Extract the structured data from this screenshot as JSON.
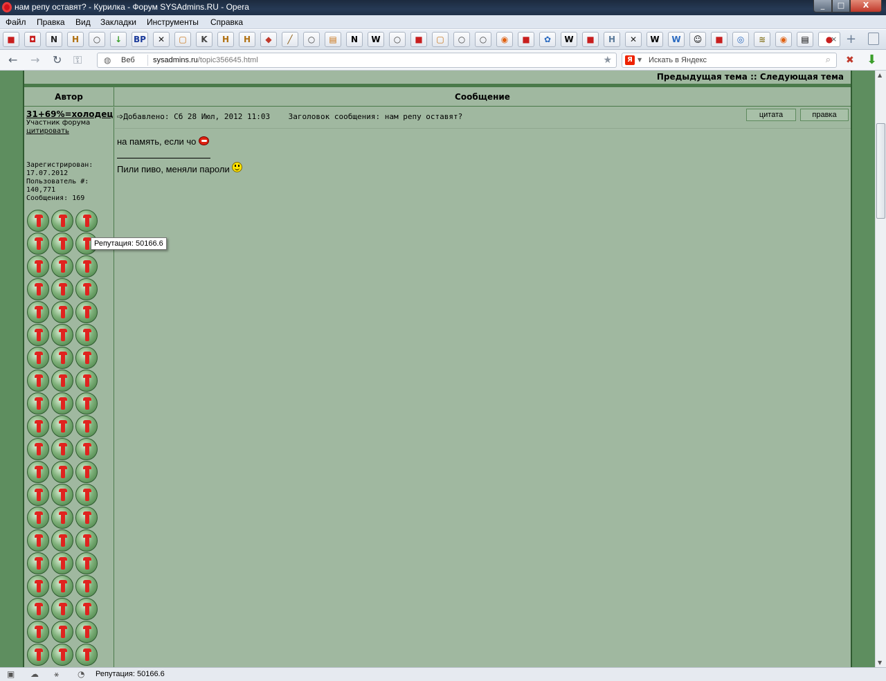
{
  "window": {
    "title": "нам репу оставят? - Курилка - Форум SYSAdmins.RU - Opera",
    "minimize": "_",
    "maximize": "□",
    "close": "X"
  },
  "menu": {
    "items": [
      "Файл",
      "Правка",
      "Вид",
      "Закладки",
      "Инструменты",
      "Справка"
    ]
  },
  "bookmarks": {
    "items": [
      "■",
      "◘",
      "N",
      "H",
      "○",
      "↓",
      "BP",
      "✕",
      "▢",
      "K",
      "H",
      "H",
      "◆",
      "╱",
      "○",
      "▤",
      "N",
      "W",
      "○",
      "■",
      "▢",
      "○",
      "○",
      "◉",
      "■",
      "✿",
      "W",
      "■",
      "H",
      "✕",
      "W",
      "W",
      "☺",
      "■",
      "◎",
      "≋",
      "◉",
      "▤",
      "●"
    ],
    "active_close": "×",
    "new_tab": "+"
  },
  "addressbar": {
    "back": "←",
    "forward": "→",
    "reload": "↻",
    "key": "⚿",
    "web_label": "Веб",
    "host": "sysadmins.ru",
    "path": "/topic356645.html",
    "star": "★",
    "search_engine": "Я",
    "search_placeholder": "Искать в Яндекс",
    "search_icon": "⌕"
  },
  "forum": {
    "nav_links": "Предыдущая тема :: Следующая тема",
    "col_author": "Автор",
    "col_message": "Сообщение",
    "author": {
      "name": "31+69%=холодец",
      "role": "Участник форума",
      "quote_link": "цитировать",
      "stats": "Зарегистрирован:\n17.07.2012\nПользователь #:\n140,771\nСообщения: 169",
      "reputation_badge_count": 60
    },
    "tooltip": "Репутация: 50166.6",
    "post": {
      "meta_arrow": "➩",
      "meta": "Добавлено: Сб 28 Июл, 2012 11:03    Заголовок сообщения: нам репу оставят?",
      "quote_button": "цитата",
      "edit_button": "правка",
      "body": "на память, если чо",
      "signature": "Пили пиво, меняли пароли"
    }
  },
  "statusbar": {
    "text": "Репутация: 50166.6"
  }
}
